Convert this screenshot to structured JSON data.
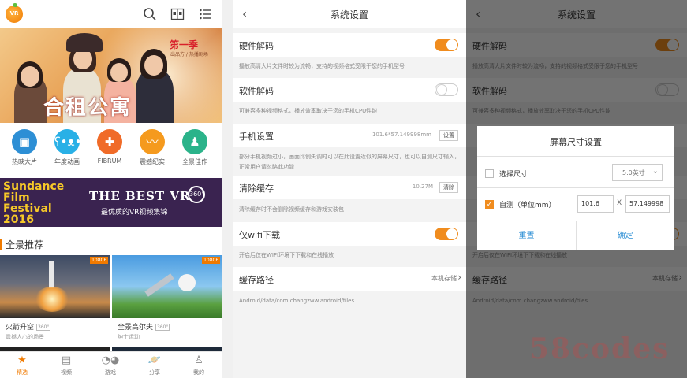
{
  "home": {
    "banner": {
      "season": "第一季",
      "season_sub": "出品方 / 热播剧场",
      "title": "合租公寓"
    },
    "categories": [
      {
        "label": "热映大片",
        "color": "#2d8fd5",
        "icon": "film-icon"
      },
      {
        "label": "年度动画",
        "color": "#29b0e6",
        "icon": "bear-icon"
      },
      {
        "label": "FIBRUM",
        "color": "#f06b28",
        "icon": "gamepad-icon"
      },
      {
        "label": "震撼纪实",
        "color": "#f59a1e",
        "icon": "dolphin-icon"
      },
      {
        "label": "全景佳作",
        "color": "#2bb38a",
        "icon": "person-icon"
      }
    ],
    "ad": {
      "left_text": "Sundance Film Festival 2016",
      "title": "THE BEST VR",
      "badge": "360°",
      "subtitle": "最优质的VR视频集锦"
    },
    "section_title": "全景推荐",
    "cards": [
      {
        "title": "火箭升空",
        "tag": "360°",
        "subtitle": "震撼人心的场景",
        "quality": "1080P"
      },
      {
        "title": "全景高尔夫",
        "tag": "360°",
        "subtitle": "绅士运动",
        "quality": "1080P"
      }
    ],
    "tabs": [
      {
        "label": "精选",
        "icon": "star-icon",
        "active": true
      },
      {
        "label": "视频",
        "icon": "video-icon",
        "active": false
      },
      {
        "label": "游戏",
        "icon": "gamepad-icon",
        "active": false
      },
      {
        "label": "分享",
        "icon": "planet-icon",
        "active": false
      },
      {
        "label": "我的",
        "icon": "user-icon",
        "active": false
      }
    ]
  },
  "settings": {
    "title": "系统设置",
    "hardware_decode": {
      "label": "硬件解码",
      "on": true,
      "desc": "播放高清大片文件时较为流畅，支持的视频格式受限于您的手机型号"
    },
    "software_decode": {
      "label": "软件解码",
      "on": false,
      "desc": "可兼容多种视频格式，播放效率取决于您的手机CPU性能"
    },
    "phone_setting": {
      "label": "手机设置",
      "value": "101.6*57.149998mm",
      "button": "设置",
      "desc": "部分手机视频过小，画面比例失调时可以在此设置近似的屏幕尺寸，也可以自测尺寸输入，正常用户请忽略此功能"
    },
    "clear_cache": {
      "label": "清除缓存",
      "value": "10.27M",
      "button": "清除",
      "desc": "清除缓存时不会删除视频缓存和游戏安装包"
    },
    "wifi_only": {
      "label": "仅wifi下载",
      "on": true,
      "desc": "开启后仅在WIFI环境下下载和在线播放"
    },
    "cache_path": {
      "label": "缓存路径",
      "value": "本机存储",
      "path": "Android/data/com.changzww.android/files"
    }
  },
  "dialog": {
    "title": "屏幕尺寸设置",
    "option_size": {
      "label": "选择尺寸",
      "checked": false,
      "select_value": "5.0英寸"
    },
    "option_custom": {
      "label": "自测（单位mm）",
      "checked": true,
      "width": "101.6",
      "sep": "X",
      "height": "57.149998"
    },
    "reset": "重置",
    "confirm": "确定"
  },
  "watermark": "58codes",
  "colors": {
    "accent": "#f08c1e",
    "dialog_button": "#2d8fd5"
  }
}
